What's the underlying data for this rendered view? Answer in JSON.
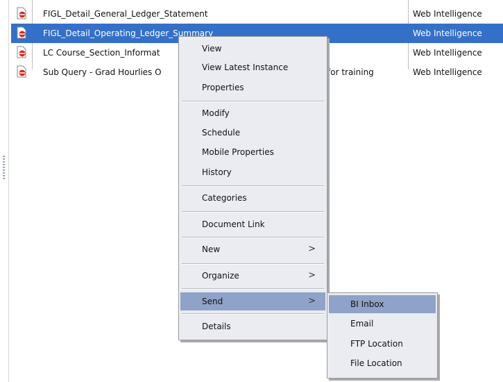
{
  "rows": [
    {
      "name": "FIGL_Detail_General_Ledger_Statement",
      "type": "Web Intelligence",
      "selected": false,
      "extra": ""
    },
    {
      "name": "FIGL_Detail_Operating_Ledger_Summary",
      "type": "Web Intelligence",
      "selected": true,
      "extra": ""
    },
    {
      "name": "LC Course_Section_Informat",
      "type": "Web Intelligence",
      "selected": false,
      "extra": ""
    },
    {
      "name": "Sub Query - Grad Hourlies O",
      "type": "Web Intelligence",
      "selected": false,
      "extra": "for training"
    }
  ],
  "context_menu": {
    "items": [
      {
        "label": "View"
      },
      {
        "label": "View Latest Instance"
      },
      {
        "label": "Properties"
      },
      {
        "label": "Modify"
      },
      {
        "label": "Schedule"
      },
      {
        "label": "Mobile Properties"
      },
      {
        "label": "History"
      },
      {
        "label": "Categories"
      },
      {
        "label": "Document Link"
      },
      {
        "label": "New",
        "arrow": ">"
      },
      {
        "label": "Organize",
        "arrow": ">"
      },
      {
        "label": "Send",
        "arrow": ">",
        "highlighted": true
      },
      {
        "label": "Details"
      }
    ]
  },
  "submenu": {
    "items": [
      {
        "label": "BI Inbox",
        "highlighted": true
      },
      {
        "label": "Email"
      },
      {
        "label": "FTP Location"
      },
      {
        "label": "File Location"
      }
    ]
  },
  "colors": {
    "selection": "#3570c8",
    "menu_bg": "#eaecf2",
    "menu_highlight": "#8fa2c8"
  }
}
